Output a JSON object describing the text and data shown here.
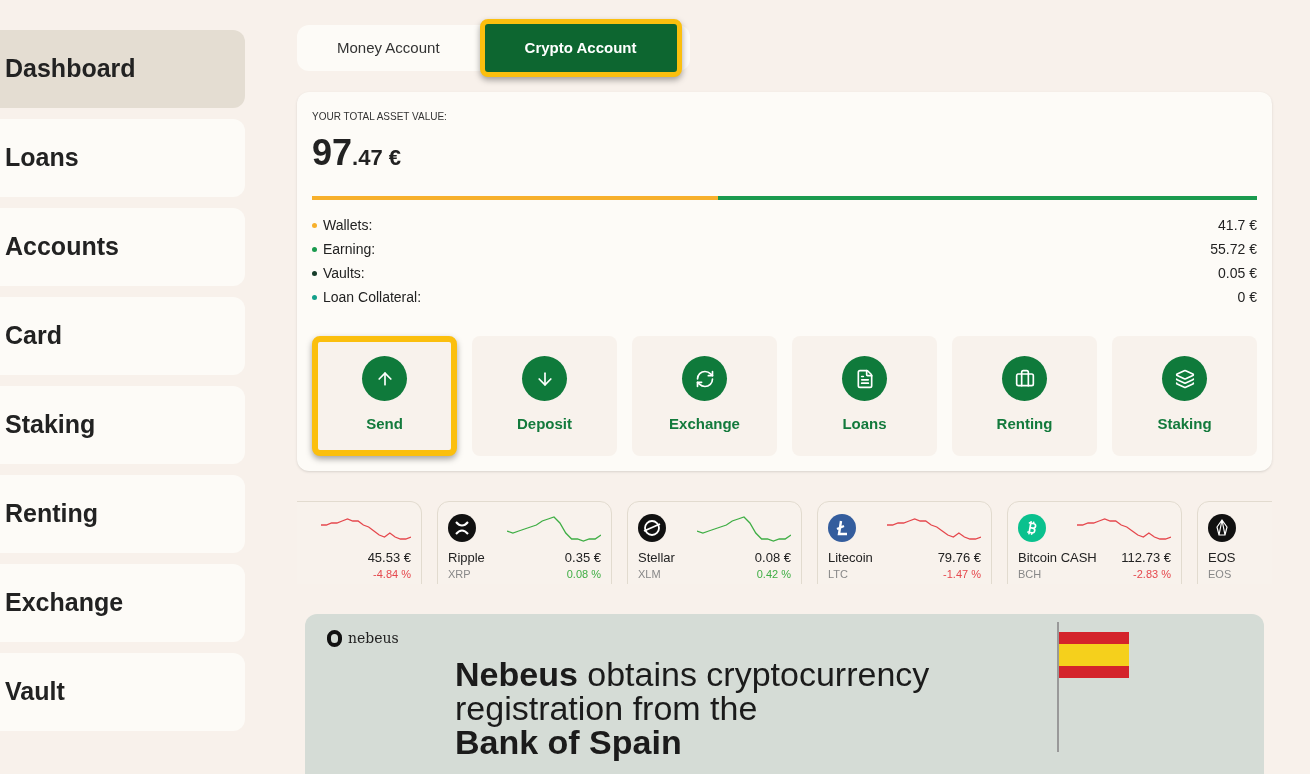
{
  "sidebar": {
    "items": [
      {
        "label": "Dashboard",
        "selected": true
      },
      {
        "label": "Loans",
        "selected": false
      },
      {
        "label": "Accounts",
        "selected": false
      },
      {
        "label": "Card",
        "selected": false
      },
      {
        "label": "Staking",
        "selected": false
      },
      {
        "label": "Renting",
        "selected": false
      },
      {
        "label": "Exchange",
        "selected": false
      },
      {
        "label": "Vault",
        "selected": false
      }
    ]
  },
  "account_tabs": [
    {
      "label": "Money Account",
      "selected": false,
      "highlighted": false
    },
    {
      "label": "Crypto Account",
      "selected": true,
      "highlighted": true
    }
  ],
  "assets": {
    "title": "YOUR TOTAL ASSET VALUE:",
    "total_whole": "97",
    "total_fraction": ".47 €",
    "breakdown": [
      {
        "label": "Wallets:",
        "value": "41.7 €",
        "color": "#f7b02c",
        "level": 0.43
      },
      {
        "label": "Earning:",
        "value": "55.72 €",
        "color": "#1a9a4e",
        "level": 0.57
      },
      {
        "label": "Vaults:",
        "value": "0.05 €",
        "color": "#163d2a"
      },
      {
        "label": "Loan Collateral:",
        "value": "0 €",
        "color": "#14a08a"
      }
    ]
  },
  "actions": [
    {
      "kind": "send",
      "label": "Send",
      "highlighted": true
    },
    {
      "kind": "deposit",
      "label": "Deposit",
      "highlighted": false
    },
    {
      "kind": "exchange",
      "label": "Exchange",
      "highlighted": false
    },
    {
      "kind": "loans",
      "label": "Loans",
      "highlighted": false
    },
    {
      "kind": "renting",
      "label": "Renting",
      "highlighted": false
    },
    {
      "kind": "staking",
      "label": "Staking",
      "highlighted": false
    }
  ],
  "tickers": [
    {
      "kind": "partial",
      "price": "45.53 €",
      "change": "-4.84 %",
      "negative": true
    },
    {
      "kind": "xrp",
      "name": "Ripple",
      "symbol": "XRP",
      "price": "0.35 €",
      "change": "0.08 %",
      "negative": false
    },
    {
      "kind": "xlm",
      "name": "Stellar",
      "symbol": "XLM",
      "price": "0.08 €",
      "change": "0.42 %",
      "negative": false
    },
    {
      "kind": "ltc",
      "name": "Litecoin",
      "symbol": "LTC",
      "price": "79.76 €",
      "change": "-1.47 %",
      "negative": true
    },
    {
      "kind": "bch",
      "name": "Bitcoin CASH",
      "symbol": "BCH",
      "price": "112.73 €",
      "change": "-2.83 %",
      "negative": true
    },
    {
      "kind": "eos",
      "name": "EOS",
      "symbol": "EOS"
    }
  ],
  "banner": {
    "brand": "nebeus",
    "headline": "**Nebeus** obtains cryptocurrency",
    "headline_2": "registration from the",
    "headline_3": "Bank of Spain"
  }
}
